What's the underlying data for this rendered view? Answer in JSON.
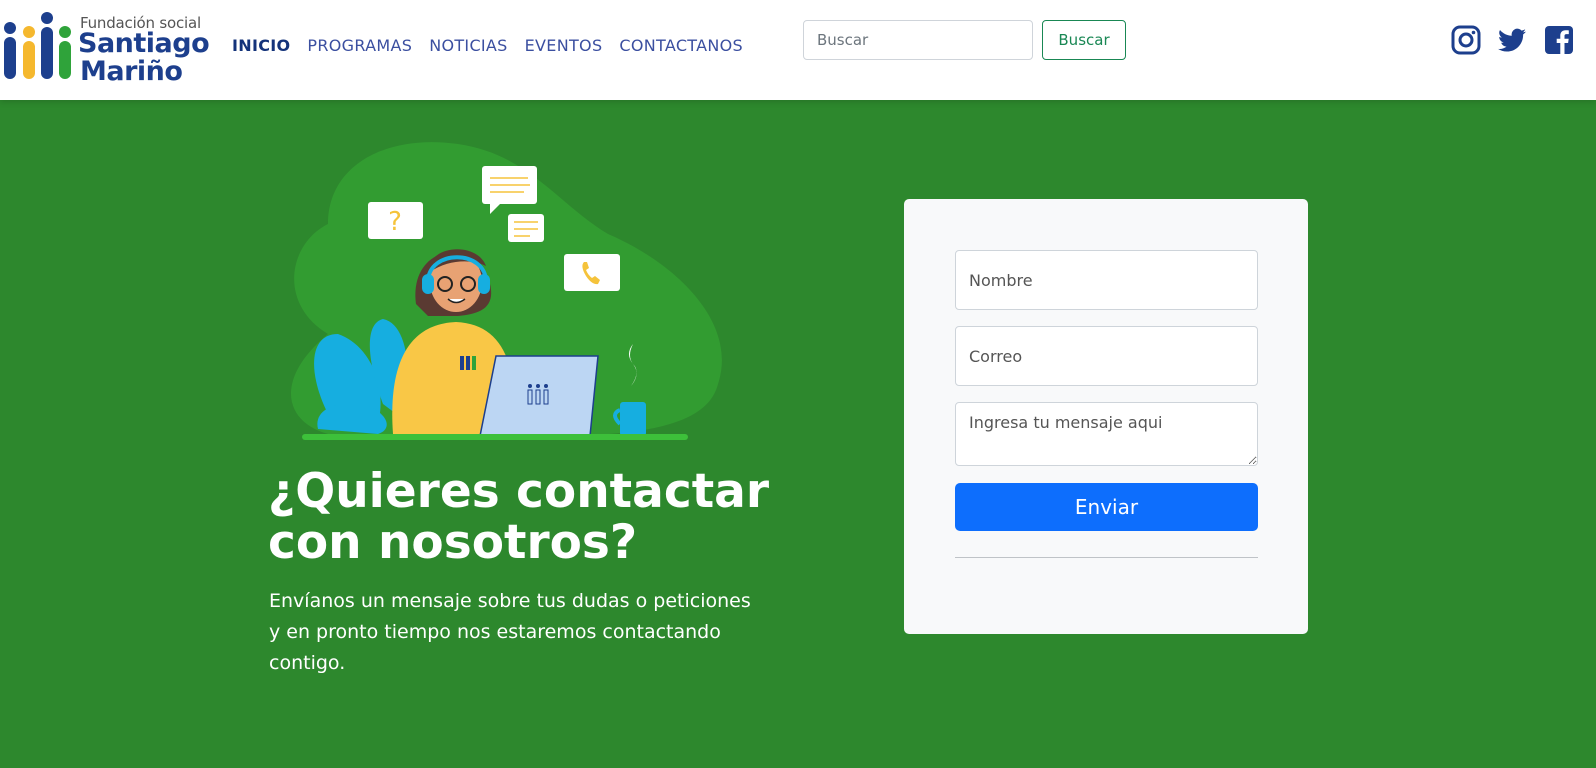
{
  "brand": {
    "small": "Fundación social",
    "line1": "Santiago",
    "line2": "Mariño"
  },
  "nav": {
    "items": [
      {
        "label": "INICIO",
        "active": true
      },
      {
        "label": "PROGRAMAS",
        "active": false
      },
      {
        "label": "NOTICIAS",
        "active": false
      },
      {
        "label": "EVENTOS",
        "active": false
      },
      {
        "label": "CONTACTANOS",
        "active": false
      }
    ]
  },
  "search": {
    "placeholder": "Buscar",
    "button_label": "Buscar"
  },
  "social": {
    "icons": [
      "instagram-icon",
      "twitter-icon",
      "facebook-icon"
    ],
    "color": "#1d3f8d"
  },
  "hero": {
    "title": "¿Quieres contactar con nosotros?",
    "text": "Envíanos un mensaje sobre tus dudas o peticiones y en pronto tiempo nos estaremos contactando contigo."
  },
  "form": {
    "name_placeholder": "Nombre",
    "email_placeholder": "Correo",
    "message_placeholder": "Ingresa tu mensaje aqui",
    "submit_label": "Enviar"
  },
  "colors": {
    "background": "#2d882d",
    "accent": "#0d6efd",
    "nav": "#3b4fa0",
    "brand_blue": "#1d3f8d",
    "search_button": "#198754"
  }
}
